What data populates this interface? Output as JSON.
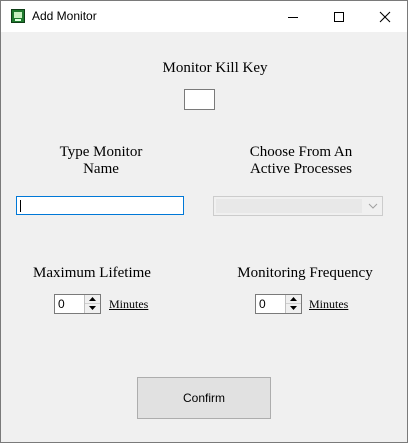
{
  "window": {
    "title": "Add Monitor",
    "icon": "monitor-app-icon"
  },
  "titlebar_buttons": {
    "minimize_icon": "minimize-icon",
    "maximize_icon": "maximize-icon",
    "close_icon": "close-icon"
  },
  "kill_key": {
    "label": "Monitor Kill Key",
    "value": ""
  },
  "monitor_name": {
    "label_line1": "Type Monitor",
    "label_line2": "Name",
    "value": ""
  },
  "process": {
    "label_line1": "Choose From An",
    "label_line2": "Active Processes",
    "selected": ""
  },
  "lifetime": {
    "label": "Maximum Lifetime",
    "value": "0",
    "unit": "Minutes"
  },
  "frequency": {
    "label": "Monitoring Frequency",
    "value": "0",
    "unit": "Minutes"
  },
  "confirm": {
    "label": "Confirm"
  },
  "colors": {
    "window_bg": "#f0f0f0",
    "focus_border": "#0078d7",
    "button_bg": "#e1e1e1"
  }
}
